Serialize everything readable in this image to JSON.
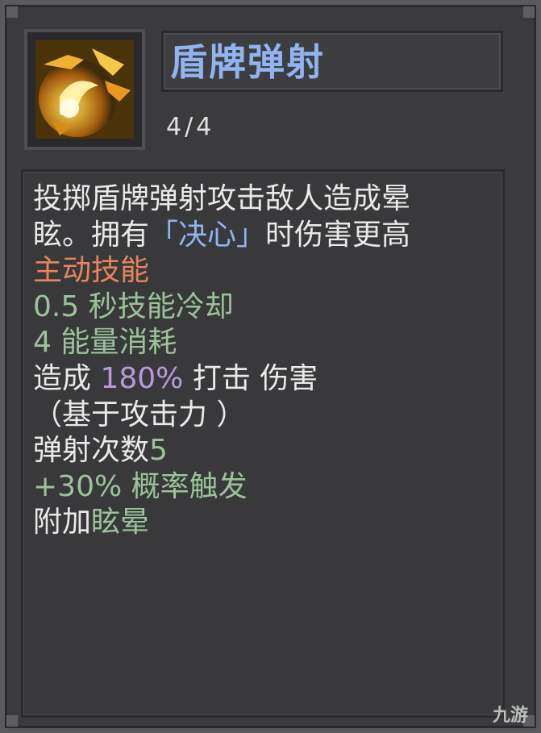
{
  "skill": {
    "name": "盾牌弹射",
    "level": "4/4",
    "icon": "shield-bounce-fireball-icon"
  },
  "description": {
    "line1": "投掷盾牌弹射攻击敌人造成晕",
    "line2_prefix": "眩。拥有",
    "line2_keyword": "「决心」",
    "line2_suffix": "时伤害更高",
    "skill_type": "主动技能",
    "cooldown": "0.5 秒技能冷却",
    "energy_cost": "4 能量消耗",
    "damage_prefix": "造成 ",
    "damage_value": "180%",
    "damage_suffix": " 打击 伤害",
    "damage_basis": "（基于攻击力 ）",
    "bounce_label": "弹射次数",
    "bounce_value": "5",
    "trigger": "+30% 概率触发",
    "extra_label": "附加",
    "extra_effect": "眩晕"
  },
  "watermark": "九游",
  "colors": {
    "title": "#8fb4f0",
    "keyword": "#8fb4f0",
    "active_skill": "#e8845a",
    "stat_green": "#9cc29a",
    "damage_purple": "#b89ad8"
  }
}
